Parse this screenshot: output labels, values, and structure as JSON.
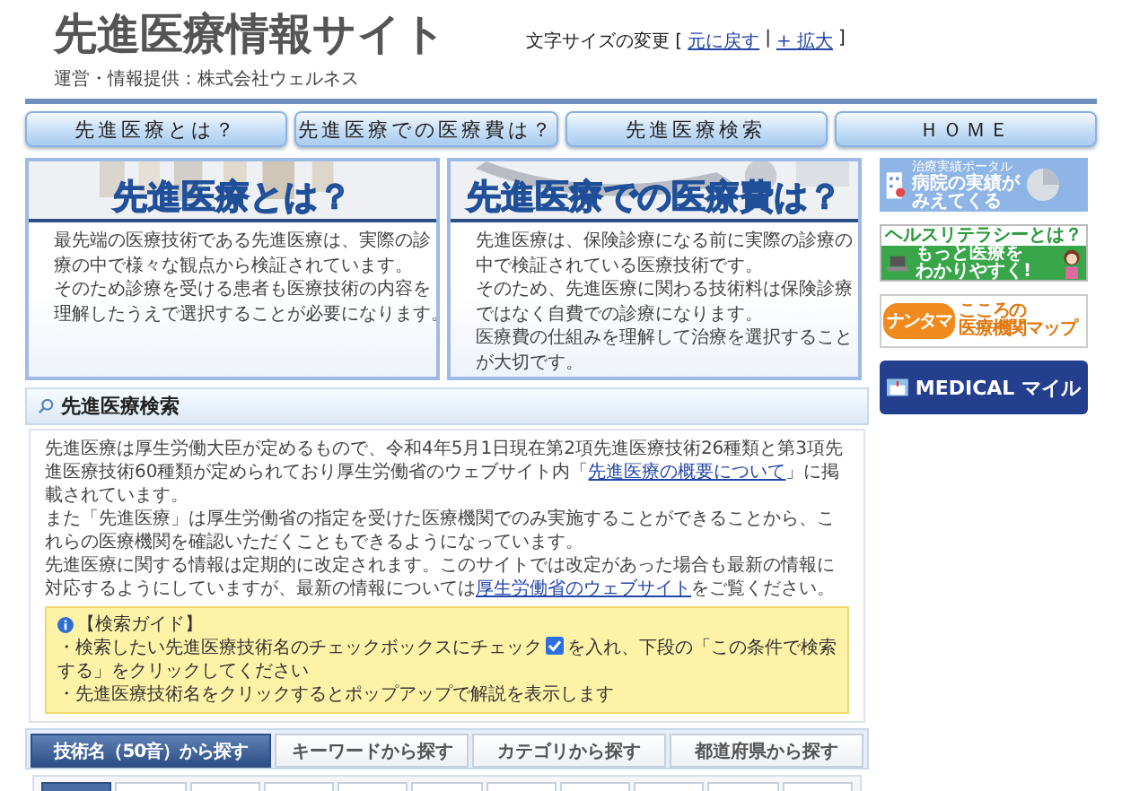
{
  "header": {
    "site_title": "先進医療情報サイト",
    "operator": "運営・情報提供：株式会社ウェルネス",
    "font_size": {
      "label": "文字サイズの変更 [",
      "links": [
        "元に戻す",
        "+ 拡大"
      ],
      "separator": "|",
      "close": "]"
    }
  },
  "nav": [
    "先進医療とは？",
    "先進医療での医療費は？",
    "先進医療検索",
    "ＨＯＭＥ"
  ],
  "panels": [
    {
      "title": "先進医療とは？",
      "lines": [
        "最先端の医療技術である先進医療は、実際の診",
        "療の中で様々な観点から検証されています。",
        "そのため診療を受ける患者も医療技術の内容を",
        "理解したうえで選択することが必要になります。"
      ]
    },
    {
      "title": "先進医療での医療費は？",
      "lines": [
        "先進医療は、保険診療になる前に実際の診療の",
        "中で検証されている医療技術です。",
        "そのため、先進医療に関わる技術料は保険診療",
        "ではなく自費での診療になります。",
        "医療費の仕組みを理解して治療を選択すること",
        "が大切です。"
      ]
    }
  ],
  "banners": [
    {
      "kind": "results",
      "caption": "治療実績ポータル",
      "lines": [
        "病院の実績が",
        "みえてくる"
      ]
    },
    {
      "kind": "literacy",
      "caption": "ヘルスリテラシーとは？",
      "lines": [
        "もっと医療を",
        "わかりやすく!"
      ]
    },
    {
      "kind": "nantama",
      "caption": "ナンタマ",
      "lines": [
        "こころの",
        "医療機関マップ"
      ]
    },
    {
      "kind": "medical",
      "caption": "MEDICAL マイル"
    }
  ],
  "search": {
    "heading": "先進医療検索",
    "paragraphs": [
      {
        "text": "先進医療は厚生労働大臣が定めるもので、令和4年5月1日現在第2項先進医療技術26種類と第3項先進医療技術60種類が定められており厚生労働省のウェブサイト内「",
        "link": "先進医療の概要について",
        "after": "」に掲載されています。"
      },
      {
        "text": "また「先進医療」は厚生労働省の指定を受けた医療機関でのみ実施することができることから、これらの医療機関を確認いただくこともできるようになっています。"
      },
      {
        "text": "先進医療に関する情報は定期的に改定されます。このサイトでは改定があった場合も最新の情報に対応するようにしていますが、最新の情報については",
        "link": "厚生労働省のウェブサイト",
        "after": "をご覧ください。"
      }
    ],
    "guide": {
      "title": "【検索ガイド】",
      "line1_before": "・検索したい先進医療技術名のチェックボックスにチェック",
      "line1_after": "を入れ、下段の「この条件で検索する」をクリックしてください",
      "line2": "・先進医療技術名をクリックするとポップアップで解説を表示します"
    },
    "tabs": [
      {
        "label": "技術名（50音）から探す",
        "selected": true
      },
      {
        "label": "キーワードから探す",
        "selected": false
      },
      {
        "label": "カテゴリから探す",
        "selected": false
      },
      {
        "label": "都道府県から探す",
        "selected": false
      }
    ],
    "index_tabs": [
      {
        "selected": true
      },
      {
        "selected": false
      },
      {
        "selected": false
      },
      {
        "selected": false
      },
      {
        "selected": false
      },
      {
        "selected": false
      },
      {
        "selected": false
      },
      {
        "selected": false
      },
      {
        "selected": false
      },
      {
        "selected": false
      },
      {
        "selected": false
      }
    ]
  }
}
